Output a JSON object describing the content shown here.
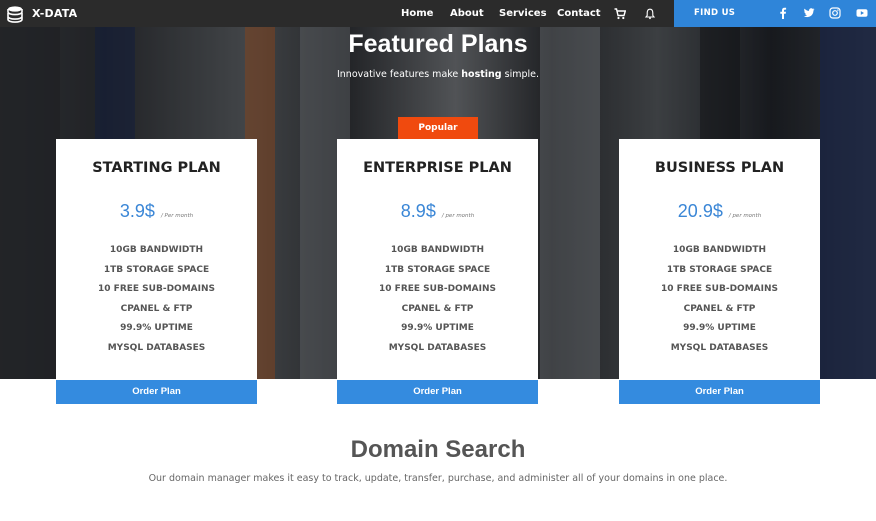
{
  "brand": {
    "name": "X-DATA",
    "logo_icon": "database-icon"
  },
  "nav": {
    "links": [
      "Home",
      "About",
      "Services",
      "Contact"
    ],
    "cart_icon": "cart-icon",
    "bell_icon": "bell-icon",
    "findus_label": "FIND US",
    "social_icons": [
      "facebook-icon",
      "twitter-icon",
      "instagram-icon",
      "youtube-icon"
    ]
  },
  "hero": {
    "title": "Featured Plans",
    "subtitle_pre": "Innovative features make ",
    "subtitle_bold": "hosting",
    "subtitle_post": " simple."
  },
  "badge": {
    "label": "Popular"
  },
  "plans": [
    {
      "name": "STARTING PLAN",
      "price": "3.9$",
      "period": "/ Per month",
      "features": [
        "10GB BANDWIDTH",
        "1TB STORAGE SPACE",
        "10 FREE SUB-DOMAINS",
        "CPANEL & FTP",
        "99.9% UPTIME",
        "MYSQL DATABASES"
      ],
      "button": "Order Plan"
    },
    {
      "name": "ENTERPRISE PLAN",
      "price": "8.9$",
      "period": "/ per month",
      "features": [
        "10GB BANDWIDTH",
        "1TB STORAGE SPACE",
        "10 FREE SUB-DOMAINS",
        "CPANEL & FTP",
        "99.9% UPTIME",
        "MYSQL DATABASES"
      ],
      "button": "Order Plan"
    },
    {
      "name": "BUSINESS PLAN",
      "price": "20.9$",
      "period": "/ per month",
      "features": [
        "10GB BANDWIDTH",
        "1TB STORAGE SPACE",
        "10 FREE SUB-DOMAINS",
        "CPANEL & FTP",
        "99.9% UPTIME",
        "MYSQL DATABASES"
      ],
      "button": "Order Plan"
    }
  ],
  "domain": {
    "title": "Domain Search",
    "description": "Our domain manager makes it easy to track, update, transfer, purchase, and administer all of your domains in one place."
  },
  "colors": {
    "navbar": "#2b2b2b",
    "accent_blue": "#348bdf",
    "price_blue": "#3a86d6",
    "popular_orange": "#f04a0e"
  }
}
